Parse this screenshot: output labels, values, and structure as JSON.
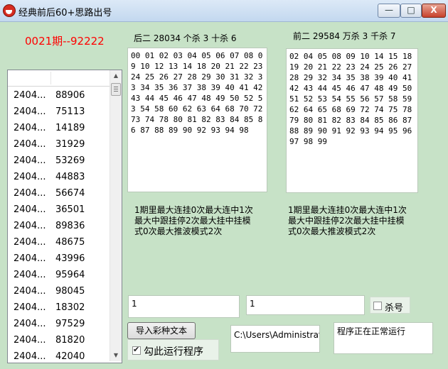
{
  "window": {
    "title": "经典前后60+思路出号",
    "min_glyph": "—",
    "max_glyph": "□",
    "close_glyph": "X"
  },
  "issue_label": "0021期--92222",
  "list": {
    "rows": [
      {
        "date": "2404...",
        "number": "88906"
      },
      {
        "date": "2404...",
        "number": "75113"
      },
      {
        "date": "2404...",
        "number": "14189"
      },
      {
        "date": "2404...",
        "number": "31929"
      },
      {
        "date": "2404...",
        "number": "53269"
      },
      {
        "date": "2404...",
        "number": "44883"
      },
      {
        "date": "2404...",
        "number": "56674"
      },
      {
        "date": "2404...",
        "number": "36501"
      },
      {
        "date": "2404...",
        "number": "89836"
      },
      {
        "date": "2404...",
        "number": "48675"
      },
      {
        "date": "2404...",
        "number": "43996"
      },
      {
        "date": "2404...",
        "number": "95964"
      },
      {
        "date": "2404...",
        "number": "98045"
      },
      {
        "date": "2404...",
        "number": "18302"
      },
      {
        "date": "2404...",
        "number": "97529"
      },
      {
        "date": "2404...",
        "number": "81820"
      },
      {
        "date": "2404...",
        "number": "42040"
      }
    ]
  },
  "back": {
    "label": "后二 28034 个杀 3 十杀 6",
    "numbers": "00 01 02 03 04 05 06 07 08 09 10 12 13 14 18 20 21 22 23 24 25 26 27 28 29 30 31 32 33 34 35 36 37 38 39 40 41 42 43 44 45 46 47 48 49 50 52 53 54 58 60 62 63 64 68 70 72 73 74 78 80 81 82 83 84 85 86 87 88 89 90 92 93 94 98",
    "summary": [
      "1期里最大连挂0次最大连中1次",
      "最大中跟挂停2次最大挂中挂模",
      "式0次最大推波模式2次"
    ]
  },
  "front": {
    "label": "前二 29584 万杀 3 千杀 7",
    "numbers": "02 04 05 08 09 10 14 15 18 19 20 21 22 23 24 25 26 27 28 29 32 34 35 38 39 40 41 42 43 44 45 46 47 48 49 50 51 52 53 54 55 56 57 58 59 62 64 65 68 69 72 74 75 78 79 80 81 82 83 84 85 86 87 88 89 90 91 92 93 94 95 96 97 98 99",
    "summary": [
      "1期里最大连挂0次最大连中1次",
      "最大中跟挂停2次最大挂中挂模",
      "式0次最大推波模式2次"
    ]
  },
  "inputs": {
    "value1": "1",
    "value2": "1"
  },
  "kill_checkbox": {
    "label": "杀号",
    "checked": false
  },
  "import_button": "导入彩种文本",
  "run_checkbox": {
    "label": "勾此运行程序",
    "checked": true
  },
  "path_value": "C:\\Users\\Administrator",
  "status_text": "程序正在正常运行"
}
